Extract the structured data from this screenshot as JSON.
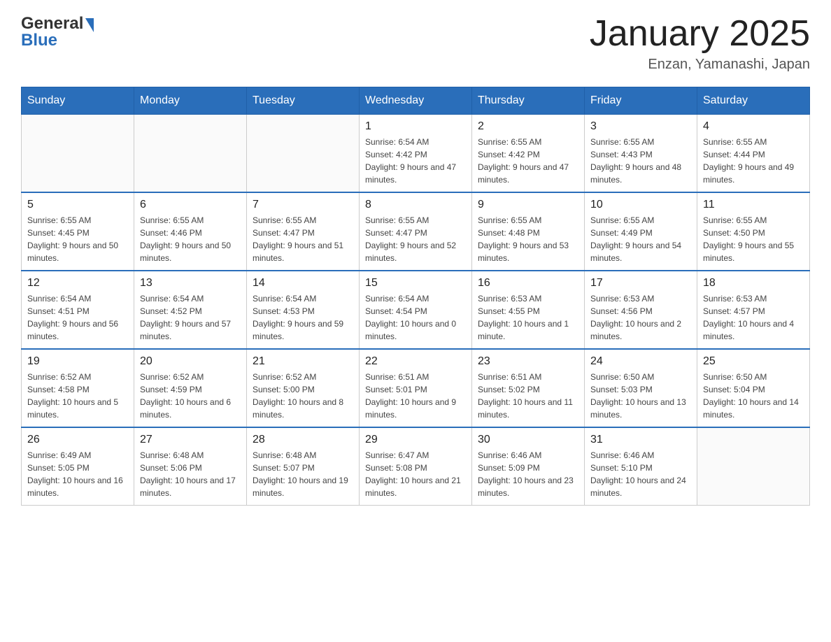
{
  "header": {
    "logo_general": "General",
    "logo_blue": "Blue",
    "month_title": "January 2025",
    "location": "Enzan, Yamanashi, Japan"
  },
  "weekdays": [
    "Sunday",
    "Monday",
    "Tuesday",
    "Wednesday",
    "Thursday",
    "Friday",
    "Saturday"
  ],
  "weeks": [
    [
      {
        "day": "",
        "sunrise": "",
        "sunset": "",
        "daylight": ""
      },
      {
        "day": "",
        "sunrise": "",
        "sunset": "",
        "daylight": ""
      },
      {
        "day": "",
        "sunrise": "",
        "sunset": "",
        "daylight": ""
      },
      {
        "day": "1",
        "sunrise": "Sunrise: 6:54 AM",
        "sunset": "Sunset: 4:42 PM",
        "daylight": "Daylight: 9 hours and 47 minutes."
      },
      {
        "day": "2",
        "sunrise": "Sunrise: 6:55 AM",
        "sunset": "Sunset: 4:42 PM",
        "daylight": "Daylight: 9 hours and 47 minutes."
      },
      {
        "day": "3",
        "sunrise": "Sunrise: 6:55 AM",
        "sunset": "Sunset: 4:43 PM",
        "daylight": "Daylight: 9 hours and 48 minutes."
      },
      {
        "day": "4",
        "sunrise": "Sunrise: 6:55 AM",
        "sunset": "Sunset: 4:44 PM",
        "daylight": "Daylight: 9 hours and 49 minutes."
      }
    ],
    [
      {
        "day": "5",
        "sunrise": "Sunrise: 6:55 AM",
        "sunset": "Sunset: 4:45 PM",
        "daylight": "Daylight: 9 hours and 50 minutes."
      },
      {
        "day": "6",
        "sunrise": "Sunrise: 6:55 AM",
        "sunset": "Sunset: 4:46 PM",
        "daylight": "Daylight: 9 hours and 50 minutes."
      },
      {
        "day": "7",
        "sunrise": "Sunrise: 6:55 AM",
        "sunset": "Sunset: 4:47 PM",
        "daylight": "Daylight: 9 hours and 51 minutes."
      },
      {
        "day": "8",
        "sunrise": "Sunrise: 6:55 AM",
        "sunset": "Sunset: 4:47 PM",
        "daylight": "Daylight: 9 hours and 52 minutes."
      },
      {
        "day": "9",
        "sunrise": "Sunrise: 6:55 AM",
        "sunset": "Sunset: 4:48 PM",
        "daylight": "Daylight: 9 hours and 53 minutes."
      },
      {
        "day": "10",
        "sunrise": "Sunrise: 6:55 AM",
        "sunset": "Sunset: 4:49 PM",
        "daylight": "Daylight: 9 hours and 54 minutes."
      },
      {
        "day": "11",
        "sunrise": "Sunrise: 6:55 AM",
        "sunset": "Sunset: 4:50 PM",
        "daylight": "Daylight: 9 hours and 55 minutes."
      }
    ],
    [
      {
        "day": "12",
        "sunrise": "Sunrise: 6:54 AM",
        "sunset": "Sunset: 4:51 PM",
        "daylight": "Daylight: 9 hours and 56 minutes."
      },
      {
        "day": "13",
        "sunrise": "Sunrise: 6:54 AM",
        "sunset": "Sunset: 4:52 PM",
        "daylight": "Daylight: 9 hours and 57 minutes."
      },
      {
        "day": "14",
        "sunrise": "Sunrise: 6:54 AM",
        "sunset": "Sunset: 4:53 PM",
        "daylight": "Daylight: 9 hours and 59 minutes."
      },
      {
        "day": "15",
        "sunrise": "Sunrise: 6:54 AM",
        "sunset": "Sunset: 4:54 PM",
        "daylight": "Daylight: 10 hours and 0 minutes."
      },
      {
        "day": "16",
        "sunrise": "Sunrise: 6:53 AM",
        "sunset": "Sunset: 4:55 PM",
        "daylight": "Daylight: 10 hours and 1 minute."
      },
      {
        "day": "17",
        "sunrise": "Sunrise: 6:53 AM",
        "sunset": "Sunset: 4:56 PM",
        "daylight": "Daylight: 10 hours and 2 minutes."
      },
      {
        "day": "18",
        "sunrise": "Sunrise: 6:53 AM",
        "sunset": "Sunset: 4:57 PM",
        "daylight": "Daylight: 10 hours and 4 minutes."
      }
    ],
    [
      {
        "day": "19",
        "sunrise": "Sunrise: 6:52 AM",
        "sunset": "Sunset: 4:58 PM",
        "daylight": "Daylight: 10 hours and 5 minutes."
      },
      {
        "day": "20",
        "sunrise": "Sunrise: 6:52 AM",
        "sunset": "Sunset: 4:59 PM",
        "daylight": "Daylight: 10 hours and 6 minutes."
      },
      {
        "day": "21",
        "sunrise": "Sunrise: 6:52 AM",
        "sunset": "Sunset: 5:00 PM",
        "daylight": "Daylight: 10 hours and 8 minutes."
      },
      {
        "day": "22",
        "sunrise": "Sunrise: 6:51 AM",
        "sunset": "Sunset: 5:01 PM",
        "daylight": "Daylight: 10 hours and 9 minutes."
      },
      {
        "day": "23",
        "sunrise": "Sunrise: 6:51 AM",
        "sunset": "Sunset: 5:02 PM",
        "daylight": "Daylight: 10 hours and 11 minutes."
      },
      {
        "day": "24",
        "sunrise": "Sunrise: 6:50 AM",
        "sunset": "Sunset: 5:03 PM",
        "daylight": "Daylight: 10 hours and 13 minutes."
      },
      {
        "day": "25",
        "sunrise": "Sunrise: 6:50 AM",
        "sunset": "Sunset: 5:04 PM",
        "daylight": "Daylight: 10 hours and 14 minutes."
      }
    ],
    [
      {
        "day": "26",
        "sunrise": "Sunrise: 6:49 AM",
        "sunset": "Sunset: 5:05 PM",
        "daylight": "Daylight: 10 hours and 16 minutes."
      },
      {
        "day": "27",
        "sunrise": "Sunrise: 6:48 AM",
        "sunset": "Sunset: 5:06 PM",
        "daylight": "Daylight: 10 hours and 17 minutes."
      },
      {
        "day": "28",
        "sunrise": "Sunrise: 6:48 AM",
        "sunset": "Sunset: 5:07 PM",
        "daylight": "Daylight: 10 hours and 19 minutes."
      },
      {
        "day": "29",
        "sunrise": "Sunrise: 6:47 AM",
        "sunset": "Sunset: 5:08 PM",
        "daylight": "Daylight: 10 hours and 21 minutes."
      },
      {
        "day": "30",
        "sunrise": "Sunrise: 6:46 AM",
        "sunset": "Sunset: 5:09 PM",
        "daylight": "Daylight: 10 hours and 23 minutes."
      },
      {
        "day": "31",
        "sunrise": "Sunrise: 6:46 AM",
        "sunset": "Sunset: 5:10 PM",
        "daylight": "Daylight: 10 hours and 24 minutes."
      },
      {
        "day": "",
        "sunrise": "",
        "sunset": "",
        "daylight": ""
      }
    ]
  ]
}
